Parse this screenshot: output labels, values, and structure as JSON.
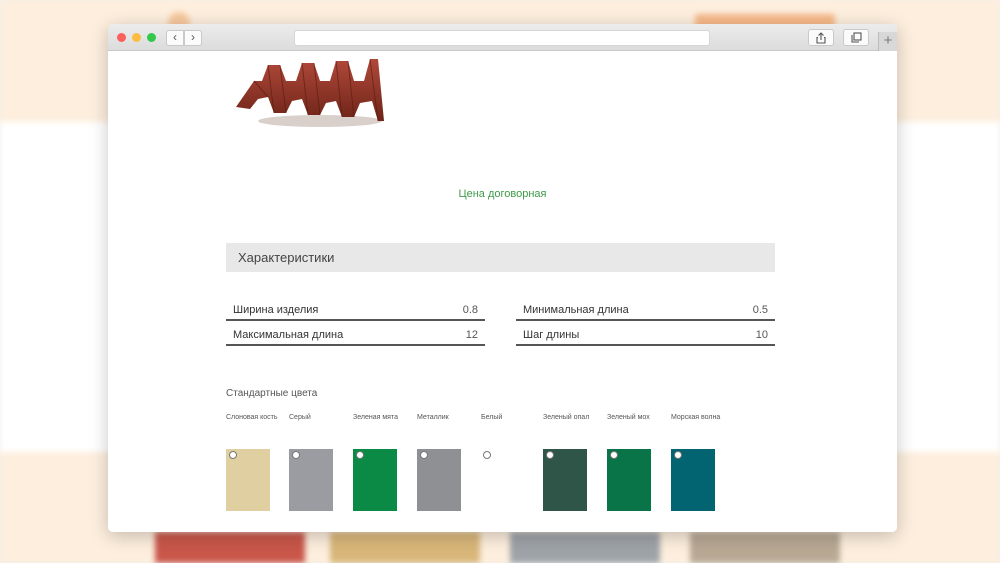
{
  "price": {
    "text": "Цена договорная"
  },
  "specs": {
    "title": "Характеристики",
    "items": [
      {
        "name": "Ширина изделия",
        "value": "0.8"
      },
      {
        "name": "Минимальная длина",
        "value": "0.5"
      },
      {
        "name": "Максимальная длина",
        "value": "12"
      },
      {
        "name": "Шаг длины",
        "value": "10"
      }
    ]
  },
  "colors": {
    "title": "Стандартные цвета",
    "items": [
      {
        "name": "Слоновая кость",
        "color": "#e0cfa0"
      },
      {
        "name": "Серый",
        "color": "#9a9ca1"
      },
      {
        "name": "Зеленая мята",
        "color": "#0b8a46"
      },
      {
        "name": "Металлик",
        "color": "#8e9093"
      },
      {
        "name": "Белый",
        "color": "#ffffff"
      },
      {
        "name": "Зеленый опал",
        "color": "#2f5448"
      },
      {
        "name": "Зеленый мох",
        "color": "#087447"
      },
      {
        "name": "Морская волна",
        "color": "#026470"
      }
    ]
  },
  "icons": {
    "back": "chevron-left-icon",
    "forward": "chevron-right-icon",
    "share": "share-icon",
    "tabs": "tabs-icon",
    "new_tab": "plus-icon"
  },
  "browser": {
    "new_tab_glyph": "+",
    "back_glyph": "‹",
    "forward_glyph": "›"
  }
}
